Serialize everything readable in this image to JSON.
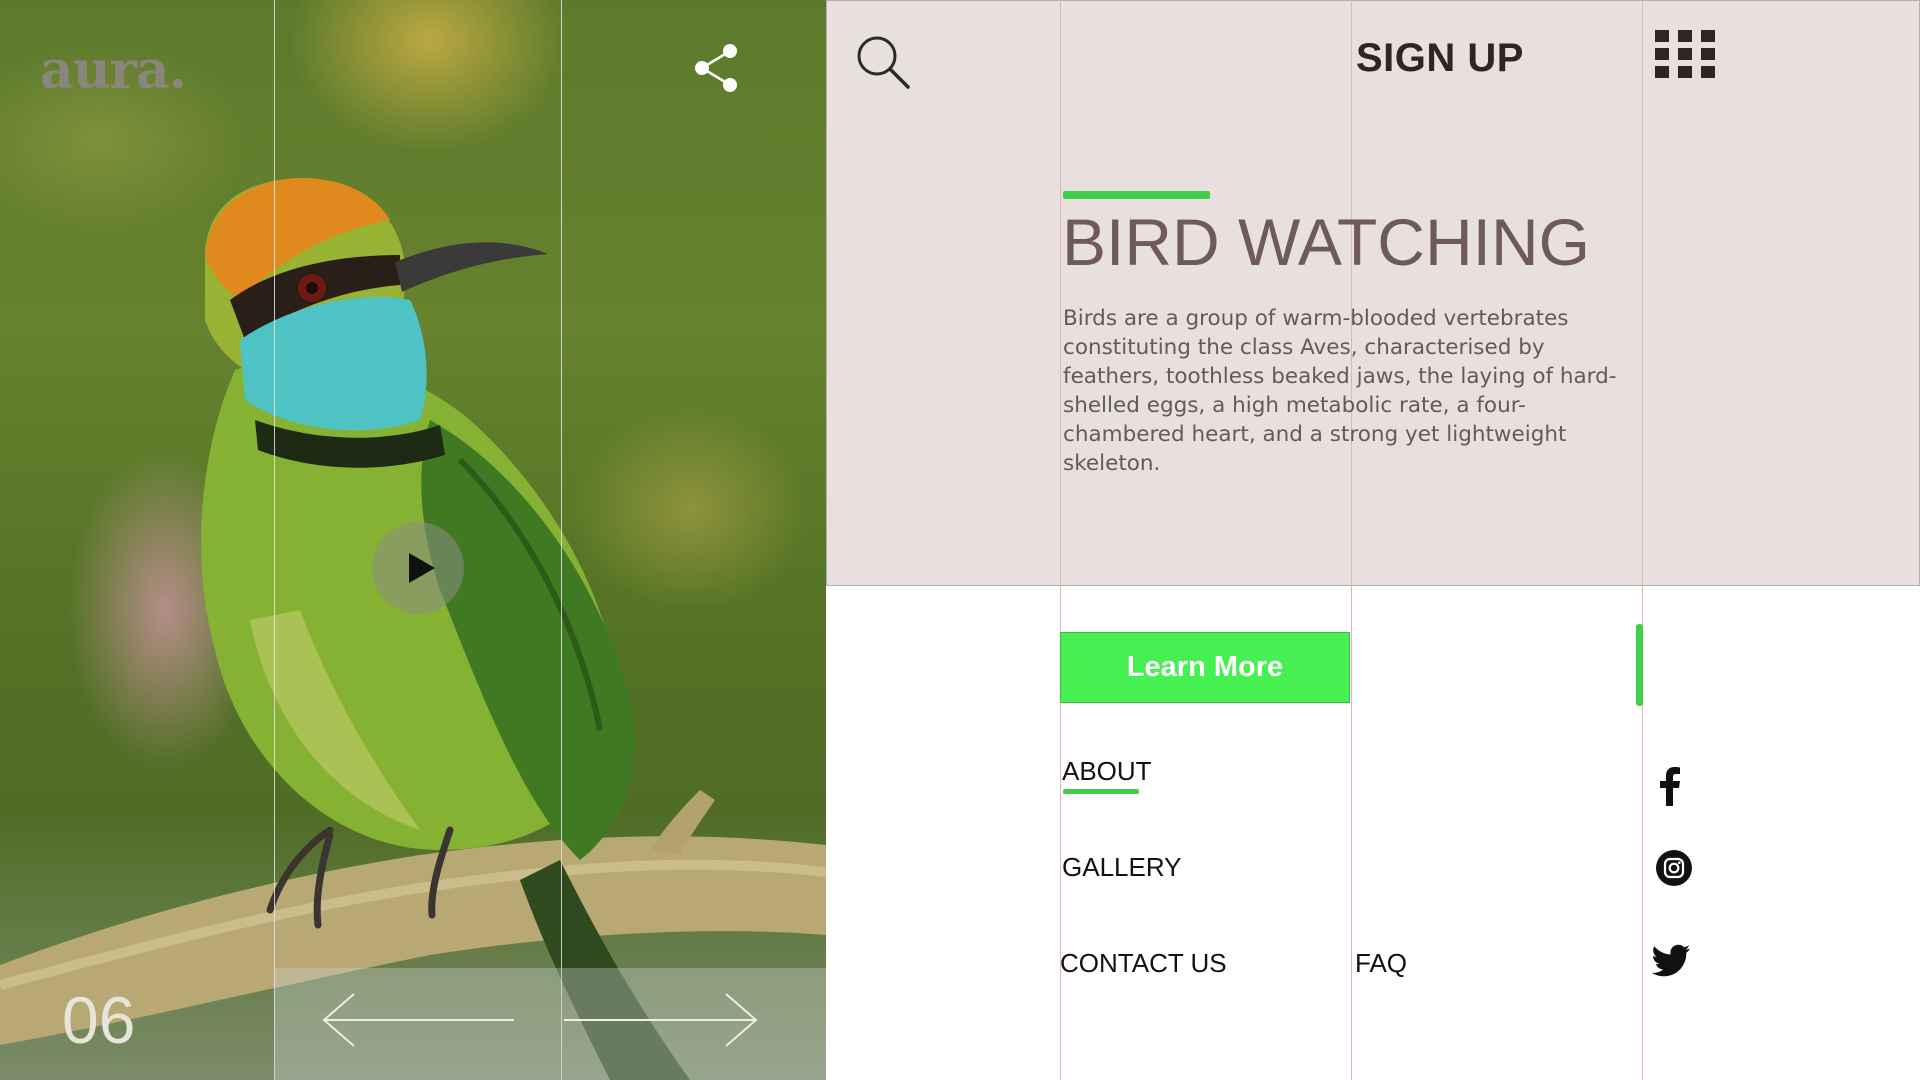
{
  "brand": {
    "name": "aura."
  },
  "slider": {
    "current_number": "06"
  },
  "header": {
    "signup_label": "SIGN UP"
  },
  "hero": {
    "title": "BIRD WATCHING",
    "description": "Birds are a group of warm-blooded vertebrates constituting the class Aves, characterised by feathers, toothless beaked jaws, the laying of hard-shelled eggs, a high metabolic rate, a four-chambered heart, and a strong yet lightweight skeleton."
  },
  "cta": {
    "learn_more_label": "Learn More"
  },
  "nav": {
    "about": "ABOUT",
    "gallery": "GALLERY",
    "contact": "CONTACT US",
    "faq": "FAQ"
  },
  "icons": {
    "share": "share-icon",
    "search": "search-icon",
    "menu": "grid-menu-icon",
    "play": "play-icon",
    "prev": "arrow-left-icon",
    "next": "arrow-right-icon",
    "facebook": "facebook-icon",
    "instagram": "instagram-icon",
    "twitter": "twitter-icon"
  },
  "colors": {
    "accent_green": "#3fcf4b",
    "button_green": "#47f052",
    "hero_background": "#e8dfdf",
    "title_color": "#6e5a5c"
  }
}
